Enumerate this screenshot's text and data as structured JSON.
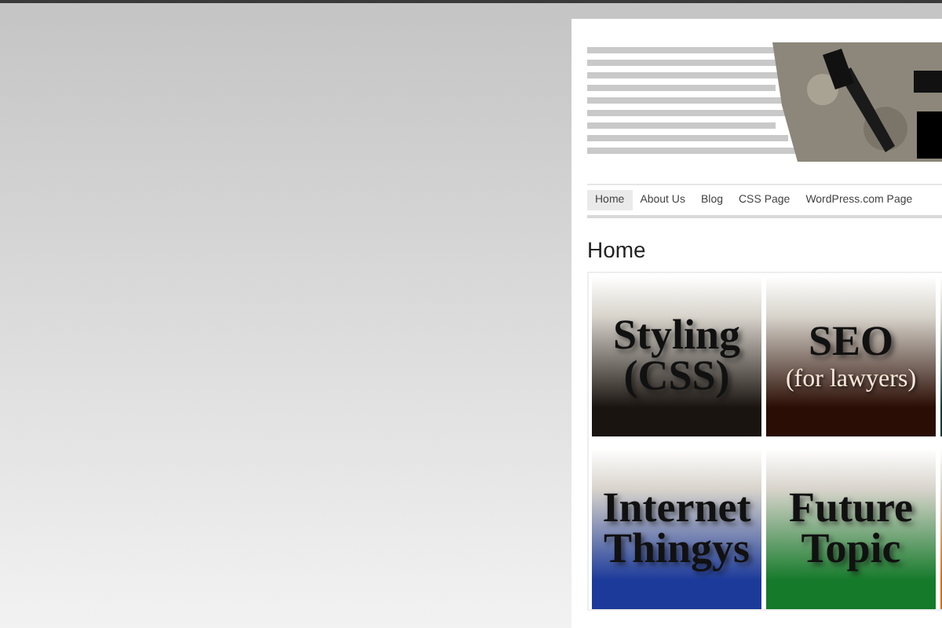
{
  "nav": [
    {
      "label": "Home",
      "selected": true
    },
    {
      "label": "About Us",
      "selected": false
    },
    {
      "label": "Blog",
      "selected": false
    },
    {
      "label": "CSS Page",
      "selected": false
    },
    {
      "label": "WordPress.com Page",
      "selected": false
    }
  ],
  "page_title": "Home",
  "tiles": [
    {
      "title": "Styling (CSS)",
      "color": "#1a1410"
    },
    {
      "title": "SEO",
      "subtitle": "(for lawyers)",
      "color": "#2a0d04"
    },
    {
      "color": "#0f3a38"
    },
    {
      "title": "Internet Thingys",
      "color": "#1c3a9a"
    },
    {
      "title": "Future Topic",
      "color": "#157a2a"
    },
    {
      "color": "#d07010"
    }
  ]
}
